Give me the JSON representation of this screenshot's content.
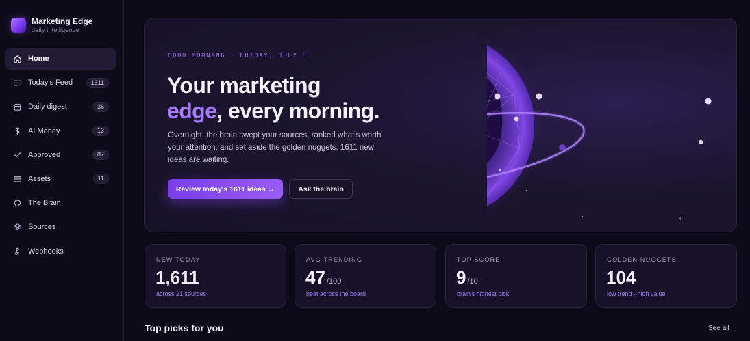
{
  "brand": {
    "name": "Marketing Edge",
    "subtitle": "daily intelligence"
  },
  "nav": [
    {
      "label": "Home",
      "icon": "home-icon",
      "active": true,
      "badge": ""
    },
    {
      "label": "Today's Feed",
      "icon": "feed-icon",
      "badge": "1611"
    },
    {
      "label": "Daily digest",
      "icon": "calendar-icon",
      "badge": "36"
    },
    {
      "label": "AI Money",
      "icon": "dollar-icon",
      "badge": "13"
    },
    {
      "label": "Approved",
      "icon": "check-icon",
      "badge": "87"
    },
    {
      "label": "Assets",
      "icon": "briefcase-icon",
      "badge": "11"
    },
    {
      "label": "The Brain",
      "icon": "brain-icon",
      "badge": ""
    },
    {
      "label": "Sources",
      "icon": "layers-icon",
      "badge": ""
    },
    {
      "label": "Webhooks",
      "icon": "webhook-icon",
      "badge": ""
    }
  ],
  "hero": {
    "greeting": "GOOD MORNING · FRIDAY, JULY 3",
    "headline_line1": "Your marketing",
    "headline_accent": "edge",
    "headline_rest": ", every morning.",
    "description": "Overnight, the brain swept your sources, ranked what's worth your attention, and set aside the golden nuggets. 1611 new ideas are waiting.",
    "primary_button": "Review today's 1611 ideas →",
    "secondary_button": "Ask the brain"
  },
  "stats": [
    {
      "label": "NEW TODAY",
      "value": "1,611",
      "suffix": "",
      "note": "across 21 sources"
    },
    {
      "label": "AVG TRENDING",
      "value": "47",
      "suffix": "/100",
      "note": "heat across the board"
    },
    {
      "label": "TOP SCORE",
      "value": "9",
      "suffix": "/10",
      "note": "brain's highest pick"
    },
    {
      "label": "GOLDEN NUGGETS",
      "value": "104",
      "suffix": "",
      "note": "low trend · high value"
    }
  ],
  "section": {
    "title": "Top picks for you",
    "see_all": "See all →"
  },
  "colors": {
    "accent": "#9a5cf5",
    "background": "#0d0a17",
    "panel": "#17122a"
  }
}
